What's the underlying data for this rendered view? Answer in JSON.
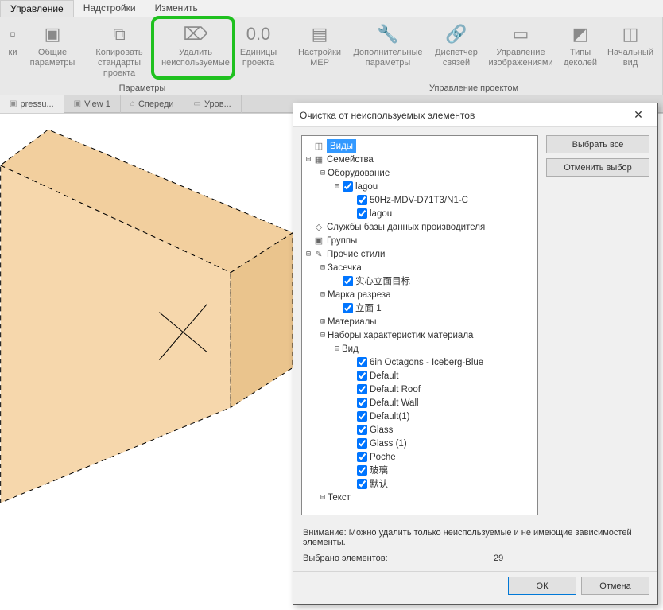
{
  "tabs": {
    "t0": "Управление",
    "t1": "Надстройки",
    "t2": "Изменить"
  },
  "ribbon": {
    "params_group": "Параметры",
    "project_group": "Управление проектом",
    "b_partial": "ки",
    "b_general": "Общие\nпараметры",
    "b_copy": "Копировать\nстандарты проекта",
    "b_purge": "Удалить\nнеиспользуемые",
    "b_units": "Единицы\nпроекта",
    "b_mep": "Настройки\nMEP",
    "b_addl": "Дополнительные\nпараметры",
    "b_links": "Диспетчер\nсвязей",
    "b_images": "Управление\nизображениями",
    "b_decals": "Типы\nдеколей",
    "b_start": "Начальный\nвид"
  },
  "viewtabs": {
    "v0": "pressu...",
    "v1": "View 1",
    "v2": "Спереди",
    "v3": "Уров..."
  },
  "dialog": {
    "title": "Очистка от неиспользуемых элементов",
    "select_all": "Выбрать все",
    "deselect_all": "Отменить выбор",
    "warn": "Внимание: Можно удалить только неиспользуемые и не имеющие зависимостей элементы.",
    "count_label": "Выбрано элементов:",
    "count_value": "29",
    "ok": "ОК",
    "cancel": "Отмена"
  },
  "tree": {
    "views": "Виды",
    "families": "Семейства",
    "equipment": "Оборудование",
    "lagou": "lagou",
    "c50hz": "50Hz-MDV-D71T3/N1-C",
    "lagou2": "lagou",
    "mfg": "Службы базы данных производителя",
    "groups": "Группы",
    "styles": "Прочие стили",
    "hatch": "Засечка",
    "hatch1": "实心立面目标",
    "section": "Марка разреза",
    "section1": "立面 1",
    "materials": "Материалы",
    "matsets": "Наборы характеристик материала",
    "appearance": "Вид",
    "m0": "6in Octagons - Iceberg-Blue",
    "m1": "Default",
    "m2": "Default Roof",
    "m3": "Default Wall",
    "m4": "Default(1)",
    "m5": "Glass",
    "m6": "Glass (1)",
    "m7": "Poche",
    "m8": "玻璃",
    "m9": "默认",
    "text": "Текст"
  }
}
